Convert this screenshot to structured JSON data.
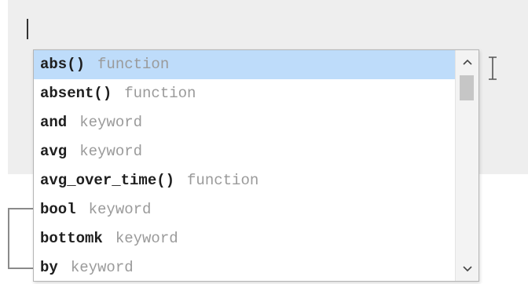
{
  "autocomplete": {
    "items": [
      {
        "label": "abs()",
        "kind": "function",
        "selected": true
      },
      {
        "label": "absent()",
        "kind": "function",
        "selected": false
      },
      {
        "label": "and",
        "kind": "keyword",
        "selected": false
      },
      {
        "label": "avg",
        "kind": "keyword",
        "selected": false
      },
      {
        "label": "avg_over_time()",
        "kind": "function",
        "selected": false
      },
      {
        "label": "bool",
        "kind": "keyword",
        "selected": false
      },
      {
        "label": "bottomk",
        "kind": "keyword",
        "selected": false
      },
      {
        "label": "by",
        "kind": "keyword",
        "selected": false
      }
    ],
    "scroll_up_icon": "chevron-up-icon",
    "scroll_down_icon": "chevron-down-icon"
  },
  "colors": {
    "selected_bg": "#bedcfa",
    "editor_bg": "#eeeeee",
    "kind_text": "#9a9a9a"
  }
}
